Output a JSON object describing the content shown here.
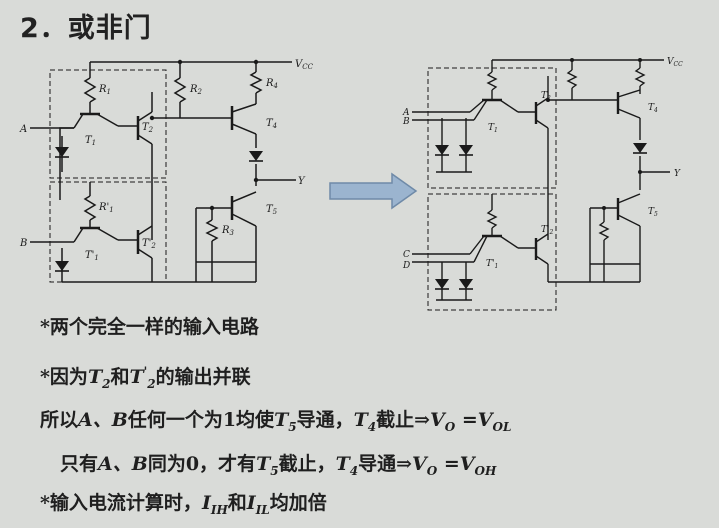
{
  "title": "2．或非门",
  "left_circuit": {
    "vcc": "V",
    "vcc_sub": "CC",
    "output": "Y",
    "inputs": [
      "A",
      "B"
    ],
    "r1": "R",
    "r1_sub": "1",
    "r1p": "R'",
    "r1p_sub": "1",
    "r2": "R",
    "r2_sub": "2",
    "r3": "R",
    "r3_sub": "3",
    "r4": "R",
    "r4_sub": "4",
    "t1": "T",
    "t1_sub": "1",
    "t1p": "T'",
    "t1p_sub": "1",
    "t2": "T",
    "t2_sub": "2",
    "t2p": "T'",
    "t2p_sub": "2",
    "t4": "T",
    "t4_sub": "4",
    "t5": "T",
    "t5_sub": "5"
  },
  "right_circuit": {
    "vcc": "V",
    "vcc_sub": "CC",
    "output": "Y",
    "inputs": [
      "A",
      "B",
      "C",
      "D"
    ],
    "t1": "T",
    "t1_sub": "1",
    "t1p": "T'",
    "t1p_sub": "1",
    "t2": "T",
    "t2_sub": "2",
    "t2p": "T'",
    "t2p_sub": "2",
    "t4": "T",
    "t4_sub": "4",
    "t5": "T",
    "t5_sub": "5"
  },
  "notes": {
    "line1": "*两个完全一样的输入电路",
    "line2_a": "*因为",
    "line2_t": "T",
    "line2_sub1": "2",
    "line2_and": "和",
    "line2_sup": "'",
    "line2_sub2": "2",
    "line2_b": "的输出并联",
    "line3_a": "所以",
    "line3_ab": "A、B",
    "line3_b": "任何一个为1均使",
    "line3_t5": "T",
    "line3_t5sub": "5",
    "line3_c": "导通，",
    "line3_t4": "T",
    "line3_t4sub": "4",
    "line3_d": "截止⇒",
    "line3_v1": "V",
    "line3_v1sub": "O",
    "line3_eq": " =",
    "line3_v2": "V",
    "line3_v2sub": "OL",
    "line4_a": "只有",
    "line4_ab": "A、B",
    "line4_b": "同为0，才有",
    "line4_t5": "T",
    "line4_t5sub": "5",
    "line4_c": "截止，",
    "line4_t4": "T",
    "line4_t4sub": "4",
    "line4_d": "导通⇒",
    "line4_v1": "V",
    "line4_v1sub": "O",
    "line4_eq": " =",
    "line4_v2": "V",
    "line4_v2sub": "OH",
    "line5_a": "*输入电流计算时，",
    "line5_i1": "I",
    "line5_i1sub": "IH",
    "line5_and": "和",
    "line5_i2": "I",
    "line5_i2sub": "IL",
    "line5_b": "均加倍"
  },
  "colors": {
    "background": "#d9dbd8",
    "arrow": "#9bb4cf",
    "arrow_stroke": "#6f8aa8"
  }
}
